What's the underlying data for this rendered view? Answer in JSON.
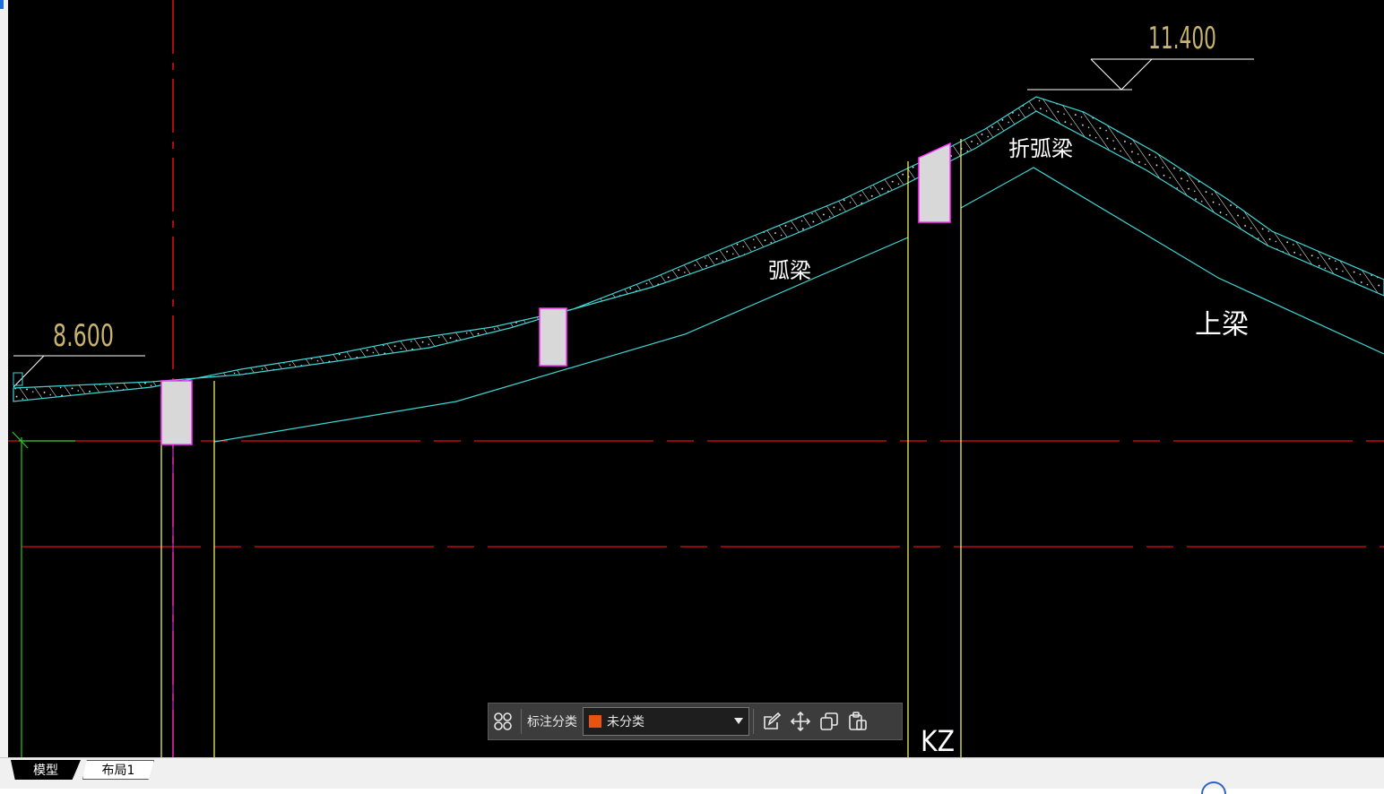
{
  "drawing": {
    "elevation_left": "8.600",
    "elevation_right": "11.400",
    "label_arc_beam": "弧梁",
    "label_bent_arc_beam": "折弧梁",
    "label_upper_beam": "上梁",
    "label_column": "KZ"
  },
  "toolbar": {
    "grid_icon": "grid-icon",
    "category_label": "标注分类",
    "category_value": "未分类",
    "category_color": "#e8540f",
    "edit_icon": "edit-icon",
    "move_icon": "move-icon",
    "copy_icon": "copy-icon",
    "paste_icon": "paste-icon"
  },
  "tabs": {
    "model": "模型",
    "layout1": "布局1"
  },
  "colors": {
    "cyan": "#3fd6d6",
    "red": "#e01010",
    "yellow": "#ffff66",
    "magenta": "#ff33ff",
    "elevation_text": "#c8b46e",
    "green": "#22cc22"
  }
}
